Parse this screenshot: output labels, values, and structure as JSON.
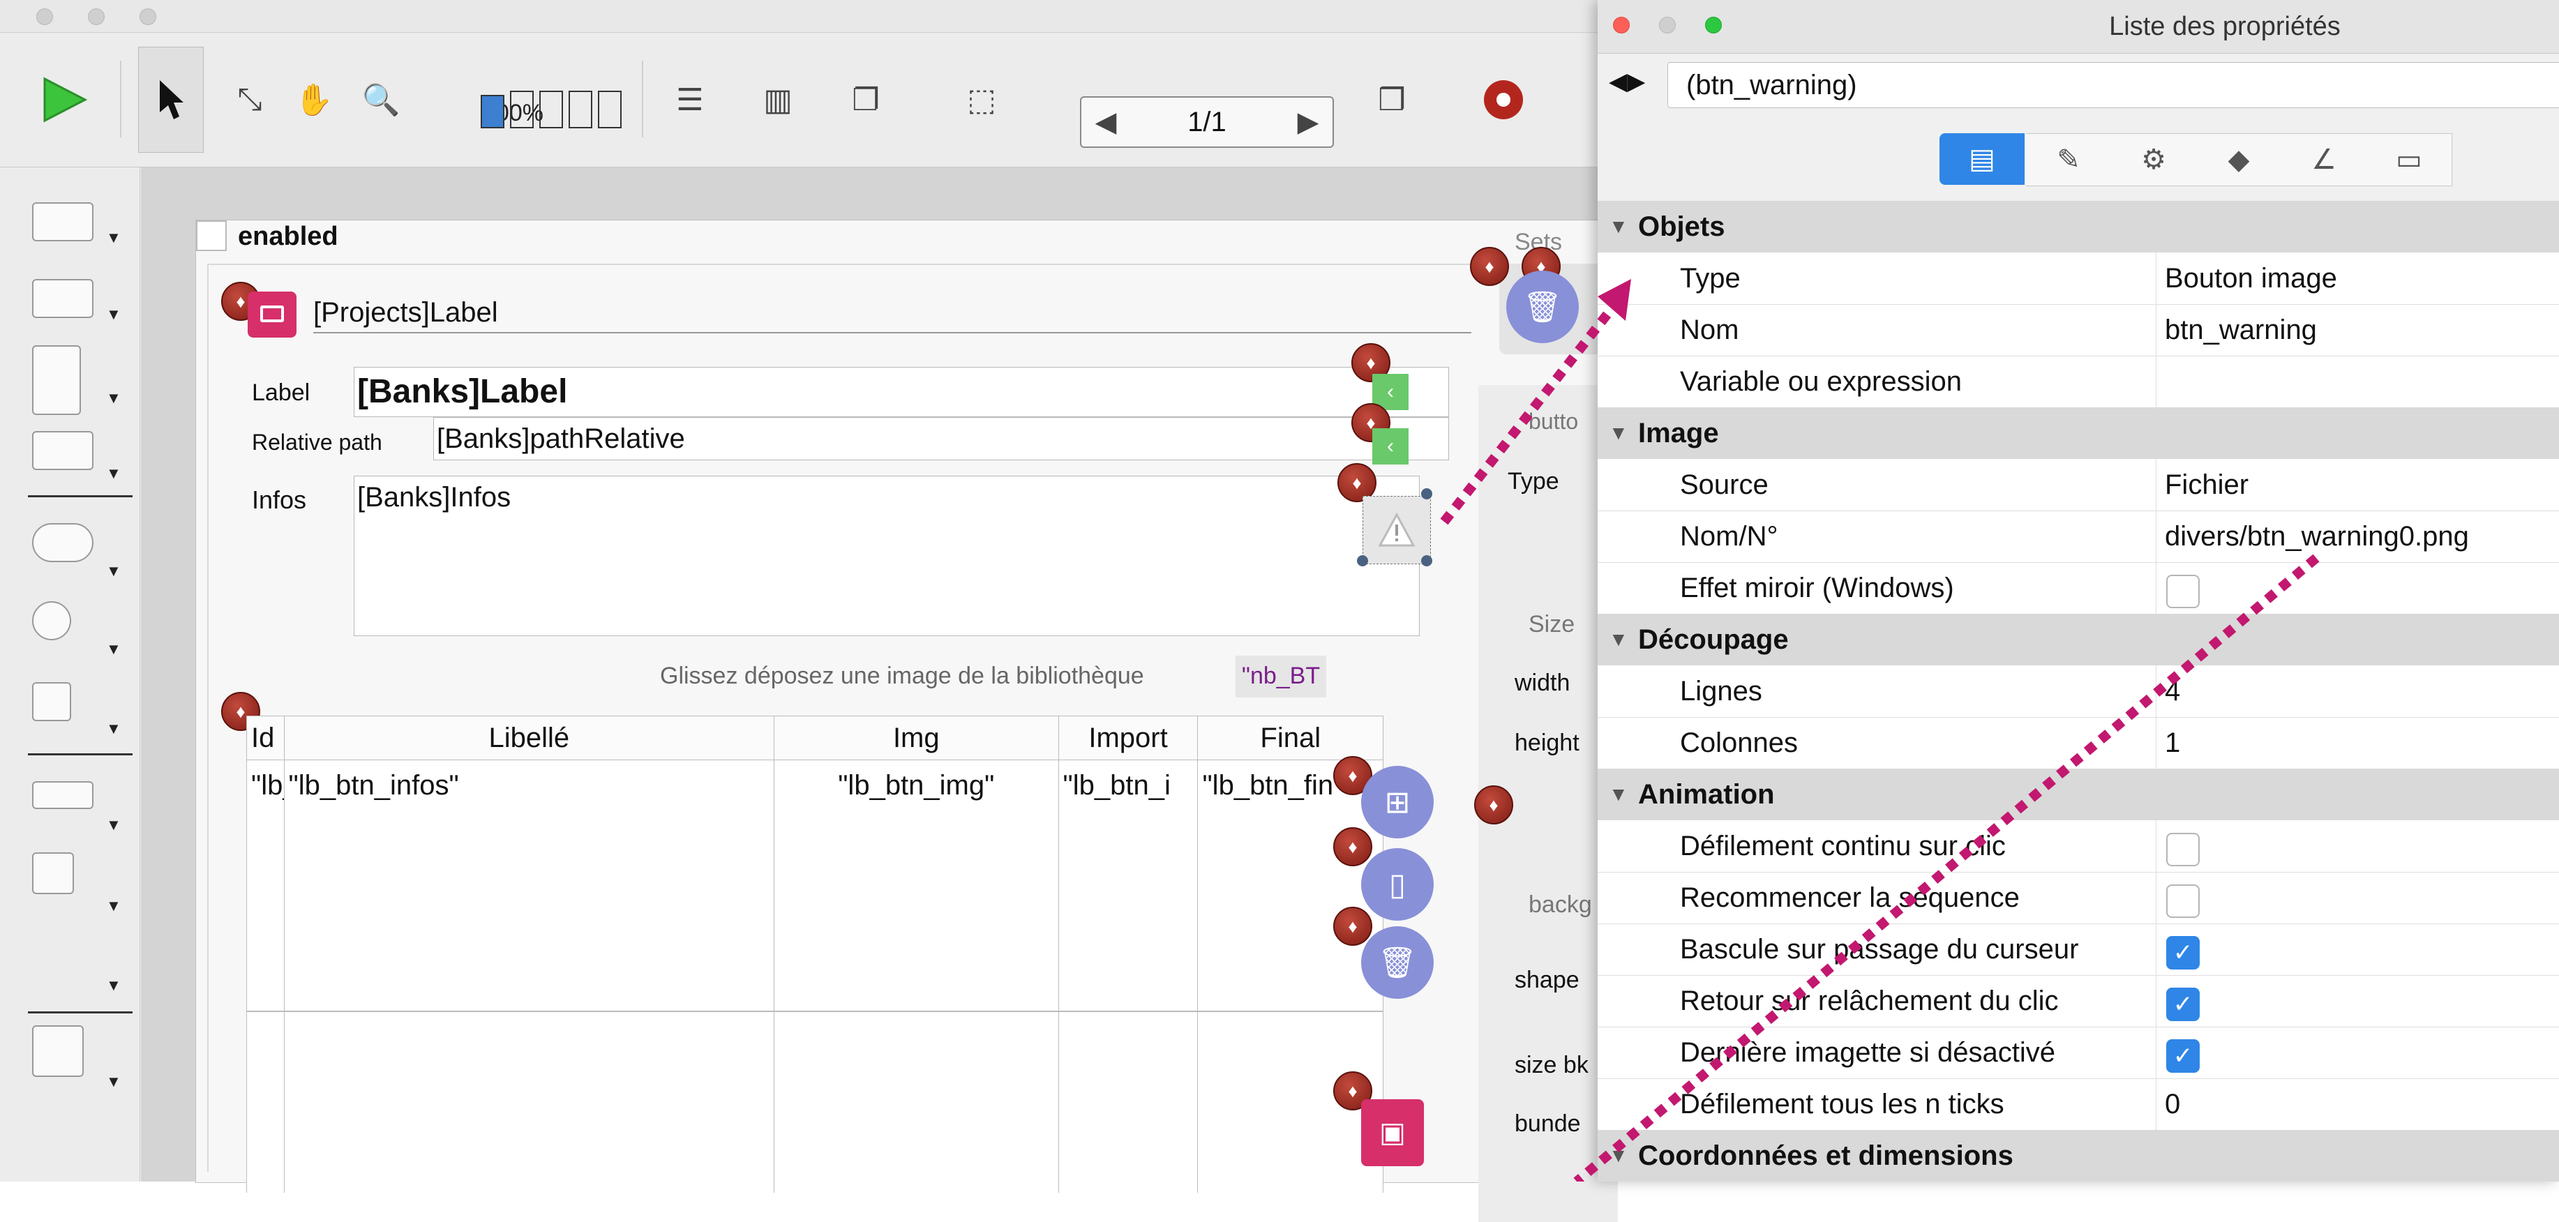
{
  "toolbar": {
    "zoom_label": "100%",
    "page_indicator": "1/1"
  },
  "form": {
    "enabled_label": "enabled",
    "projects_label": "[Projects]Label",
    "label_caption": "Label",
    "label_value": "[Banks]Label",
    "relative_path_caption": "Relative path",
    "relative_path_value": "[Banks]pathRelative",
    "infos_caption": "Infos",
    "infos_value": "[Banks]Infos",
    "drop_hint": "Glissez déposez une image de la bibliothèque",
    "nb_bt": "\"nb_BT",
    "sets_label": "Sets",
    "right_panel": {
      "button_group": "butto",
      "type_label": "Type",
      "size_label": "Size",
      "width_label": "width",
      "height_label": "height",
      "background_label": "backg",
      "shape_label": "shape",
      "size_bk_label": "size bk",
      "bundle_label": "bunde"
    },
    "table": {
      "columns": [
        "Id",
        "Libellé",
        "Img",
        "Import",
        "Final"
      ],
      "row": [
        "\"lb_",
        "\"lb_btn_infos\"",
        "\"lb_btn_img\"",
        "\"lb_btn_i",
        "\"lb_btn_fin"
      ]
    }
  },
  "properties": {
    "window_title": "Liste des propriétés",
    "object_name": "(btn_warning)",
    "sections": {
      "objets": "Objets",
      "image": "Image",
      "decoupage": "Découpage",
      "animation": "Animation",
      "coords": "Coordonnées et dimensions"
    },
    "rows": {
      "type": {
        "key": "Type",
        "value": "Bouton image"
      },
      "nom": {
        "key": "Nom",
        "value": "btn_warning"
      },
      "variable": {
        "key": "Variable ou expression",
        "value": ""
      },
      "source": {
        "key": "Source",
        "value": "Fichier"
      },
      "nom_num": {
        "key": "Nom/N°",
        "value": "divers/btn_warning0.png"
      },
      "miroir": {
        "key": "Effet miroir (Windows)",
        "checked": false
      },
      "lignes": {
        "key": "Lignes",
        "value": "4"
      },
      "colonnes": {
        "key": "Colonnes",
        "value": "1"
      },
      "defilement_continu": {
        "key": "Défilement continu sur clic",
        "checked": false
      },
      "recommencer": {
        "key": "Recommencer la séquence",
        "checked": false
      },
      "bascule": {
        "key": "Bascule sur passage du curseur",
        "checked": true
      },
      "retour": {
        "key": "Retour sur relâchement du clic",
        "checked": true
      },
      "derniere": {
        "key": "Dernière imagette si désactivé",
        "checked": true
      },
      "defilement_n": {
        "key": "Défilement tous les n ticks",
        "value": "0"
      }
    }
  },
  "colors": {
    "accent": "#2f86e6",
    "annotation": "#c2186f",
    "badge": "#8b2419",
    "circle_button": "#8890d8",
    "image_button": "#d62f6a"
  }
}
